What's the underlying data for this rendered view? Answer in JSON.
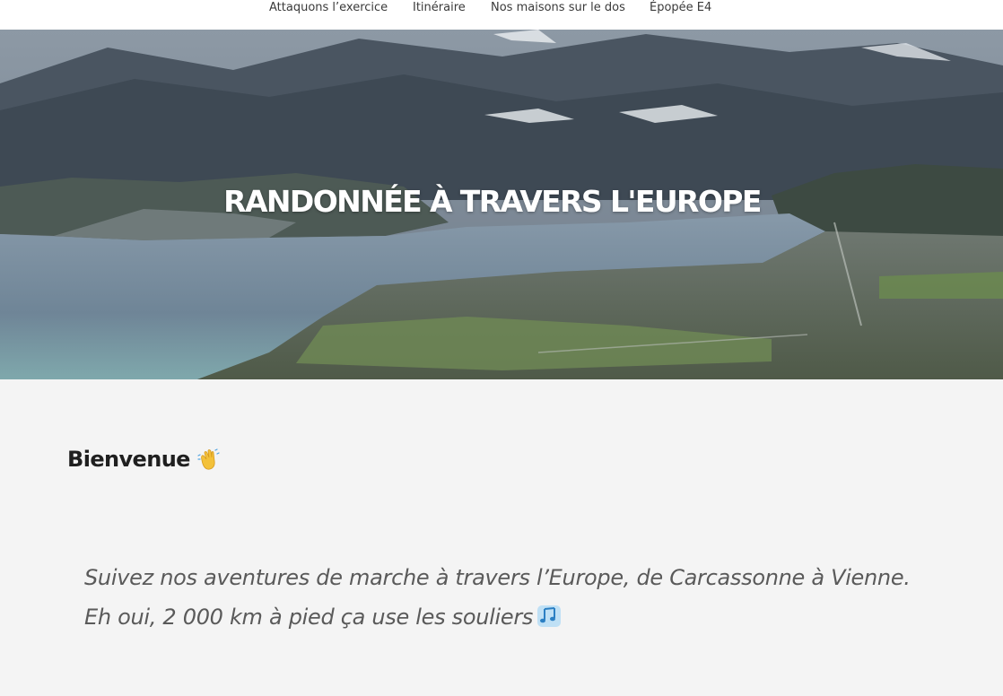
{
  "nav": {
    "items": [
      {
        "label": "Attaquons l’exercice"
      },
      {
        "label": "Itinéraire"
      },
      {
        "label": "Nos maisons sur le dos"
      },
      {
        "label": "Épopée E4"
      }
    ]
  },
  "hero": {
    "title": "RANDONNÉE À TRAVERS L'EUROPE"
  },
  "welcome": {
    "heading": "Bienvenue",
    "icon": "waving-hand-icon"
  },
  "intro": {
    "text": "Suivez nos aventures de marche à travers l’Europe, de Carcassonne à Vienne. Eh oui, 2 000 km à pied ça use les souliers",
    "icon": "musical-notes-icon"
  },
  "colors": {
    "nav_bg": "#ffffff",
    "page_bg": "#f4f4f4",
    "heading": "#1f1f1f",
    "lead_text": "#5a5a5a",
    "lake": "#7f95a6",
    "mountains": "#3f4b57"
  }
}
